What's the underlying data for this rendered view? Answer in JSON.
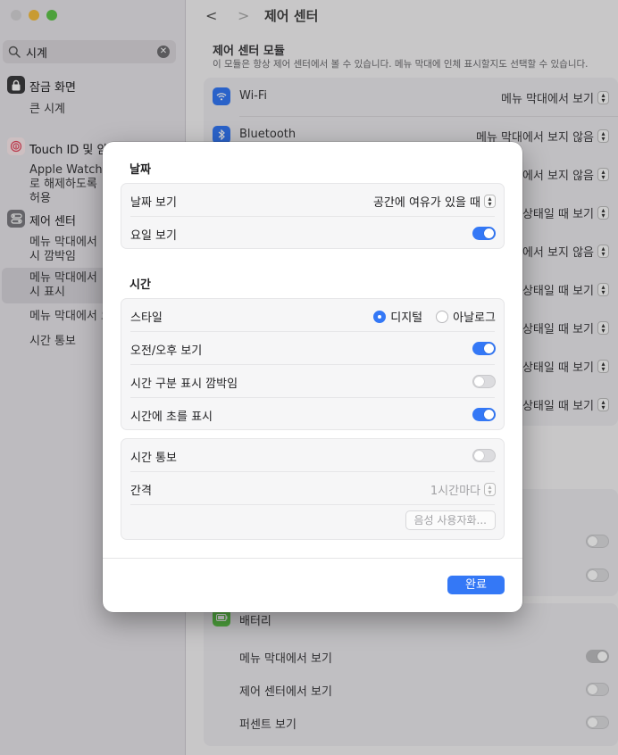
{
  "sidebar": {
    "search_value": "시계",
    "items": [
      {
        "label": "잠금 화면"
      },
      {
        "label": "큰 시계"
      },
      {
        "label": "Touch ID 및 암"
      },
      {
        "label": "Apple Watch로 해제하도록 허용"
      },
      {
        "label": "제어 센터"
      },
      {
        "label": "메뉴 막대에서 시 깜박임"
      },
      {
        "label": "메뉴 막대에서 시 표시"
      },
      {
        "label": "메뉴 막대에서 오"
      },
      {
        "label": "시간 통보"
      }
    ]
  },
  "header": {
    "back": "<",
    "forward": ">",
    "title": "제어 센터"
  },
  "main": {
    "section_title": "제어 센터 모듈",
    "section_desc": "이 모듈은 항상 제어 센터에서 볼 수 있습니다. 메뉴 막대에 인체 표시할지도 선택할 수 있습니다.",
    "rows": [
      {
        "name": "Wi-Fi",
        "value": "메뉴 막대에서 보기"
      },
      {
        "name": "Bluetooth",
        "value": "메뉴 막대에서 보지 않음"
      },
      {
        "name": "",
        "value": "에서 보지 않음"
      },
      {
        "name": "",
        "value": "상태일 때 보기"
      },
      {
        "name": "",
        "value": "에서 보지 않음"
      },
      {
        "name": "",
        "value": "상태일 때 보기"
      },
      {
        "name": "",
        "value": "상태일 때 보기"
      },
      {
        "name": "",
        "value": "상태일 때 보기"
      },
      {
        "name": "",
        "value": "상태일 때 보기"
      }
    ],
    "battery": {
      "title": "배터리",
      "rows": [
        {
          "label": "메뉴 막대에서 보기",
          "on": true
        },
        {
          "label": "제어 센터에서 보기",
          "on": false
        },
        {
          "label": "퍼센트 보기",
          "on": false
        }
      ]
    }
  },
  "sheet": {
    "date_header": "날짜",
    "show_date_label": "날짜 보기",
    "show_date_value": "공간에 여유가 있을 때",
    "show_weekday_label": "요일 보기",
    "show_weekday_on": true,
    "time_header": "시간",
    "style_label": "스타일",
    "style_digital": "디지털",
    "style_analog": "아날로그",
    "style_selected": "디지털",
    "ampm_label": "오전/오후 보기",
    "ampm_on": true,
    "flash_label": "시간 구분 표시 깜박임",
    "flash_on": false,
    "seconds_label": "시간에 초를 표시",
    "seconds_on": true,
    "announce_label": "시간 통보",
    "announce_on": false,
    "interval_label": "간격",
    "interval_value": "1시간마다",
    "voice_button": "음성 사용자화...",
    "done_button": "완료"
  },
  "colors": {
    "accent": "#3478f6",
    "traffic_close": "#d5d3d6",
    "traffic_min": "#f5bd3f",
    "traffic_max": "#5ec54a"
  }
}
